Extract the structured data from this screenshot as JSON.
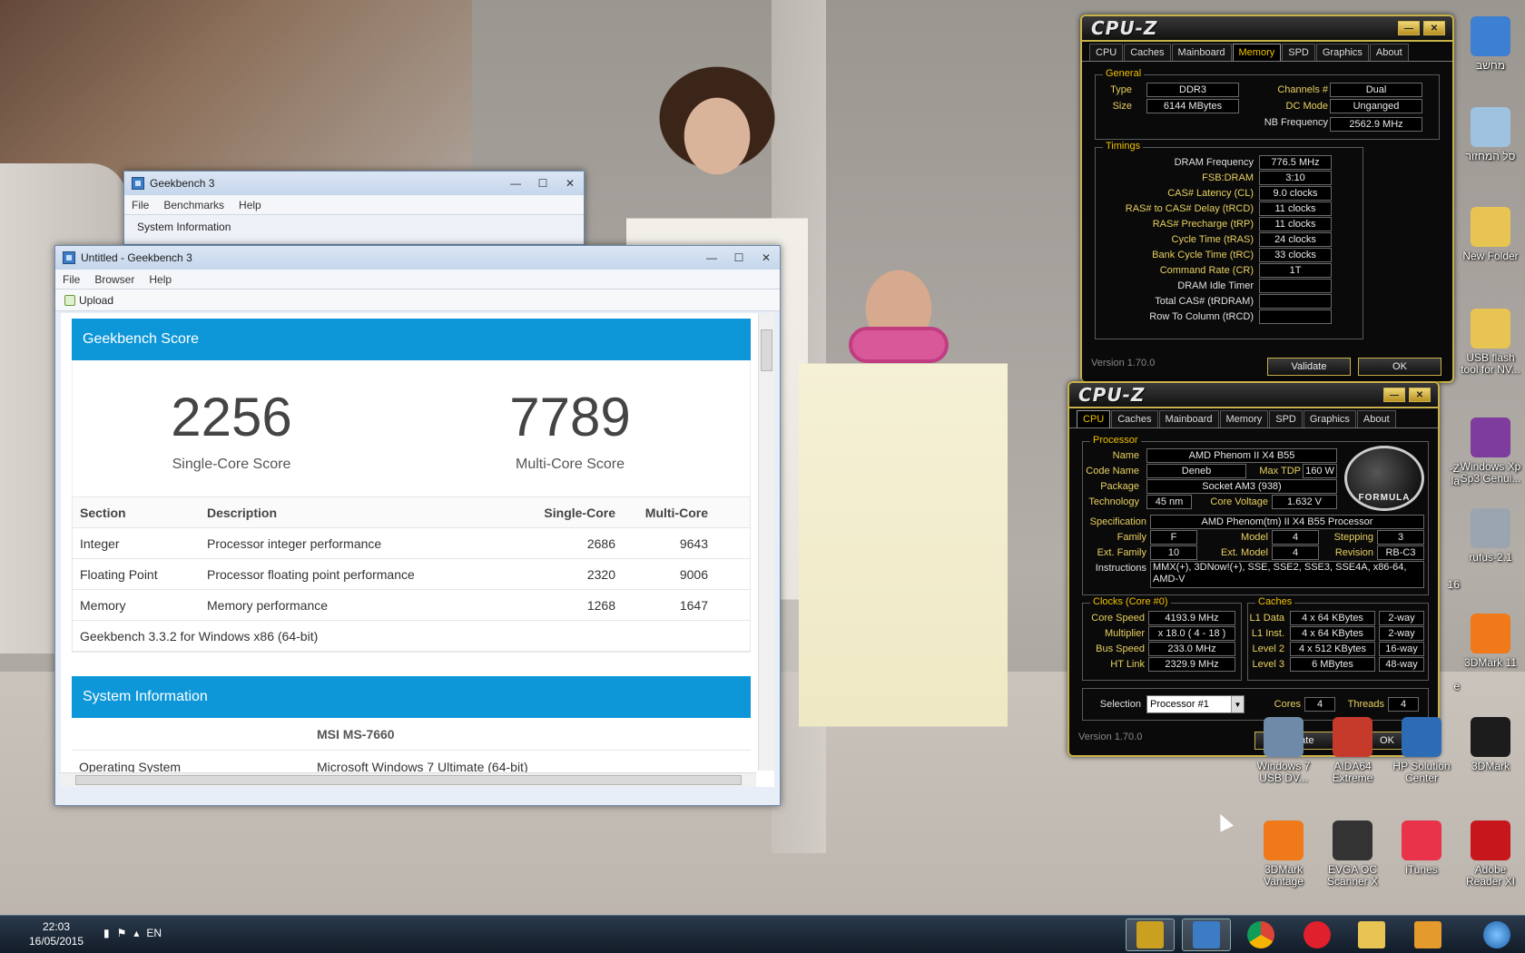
{
  "gb_back": {
    "title": "Geekbench 3",
    "menu": [
      "File",
      "Benchmarks",
      "Help"
    ],
    "section_label": "System Information",
    "btn_min": "—",
    "btn_max": "☐",
    "btn_close": "✕"
  },
  "gb_main": {
    "title": "Untitled - Geekbench 3",
    "menu": [
      "File",
      "Browser",
      "Help"
    ],
    "upload_label": "Upload",
    "score_header": "Geekbench Score",
    "single_score": "2256",
    "single_label": "Single-Core Score",
    "multi_score": "7789",
    "multi_label": "Multi-Core Score",
    "table_headers": [
      "Section",
      "Description",
      "Single-Core",
      "Multi-Core"
    ],
    "rows": [
      {
        "section": "Integer",
        "description": "Processor integer performance",
        "single": "2686",
        "multi": "9643"
      },
      {
        "section": "Floating Point",
        "description": "Processor floating point performance",
        "single": "2320",
        "multi": "9006"
      },
      {
        "section": "Memory",
        "description": "Memory performance",
        "single": "1268",
        "multi": "1647"
      }
    ],
    "version_note": "Geekbench 3.3.2 for Windows x86 (64-bit)",
    "sys_header": "System Information",
    "sys_model": "MSI MS-7660",
    "os_label": "Operating System",
    "os_value": "Microsoft Windows 7 Ultimate (64-bit)"
  },
  "cpuz_mem": {
    "logo": "CPU-Z",
    "tabs": [
      "CPU",
      "Caches",
      "Mainboard",
      "Memory",
      "SPD",
      "Graphics",
      "About"
    ],
    "general_label": "General",
    "type_label": "Type",
    "type": "DDR3",
    "size_label": "Size",
    "size": "6144 MBytes",
    "channels_label": "Channels #",
    "channels": "Dual",
    "dcmode_label": "DC Mode",
    "dcmode": "Unganged",
    "nbfreq_label": "NB Frequency",
    "nbfreq": "2562.9 MHz",
    "timings_label": "Timings",
    "timings": [
      {
        "label": "DRAM Frequency",
        "value": "776.5 MHz"
      },
      {
        "label": "FSB:DRAM",
        "value": "3:10"
      },
      {
        "label": "CAS# Latency (CL)",
        "value": "9.0 clocks"
      },
      {
        "label": "RAS# to CAS# Delay (tRCD)",
        "value": "11 clocks"
      },
      {
        "label": "RAS# Precharge (tRP)",
        "value": "11 clocks"
      },
      {
        "label": "Cycle Time (tRAS)",
        "value": "24 clocks"
      },
      {
        "label": "Bank Cycle Time (tRC)",
        "value": "33 clocks"
      },
      {
        "label": "Command Rate (CR)",
        "value": "1T"
      },
      {
        "label": "DRAM Idle Timer",
        "value": ""
      },
      {
        "label": "Total CAS# (tRDRAM)",
        "value": ""
      },
      {
        "label": "Row To Column (tRCD)",
        "value": ""
      }
    ],
    "version": "Version 1.70.0",
    "validate": "Validate",
    "ok": "OK"
  },
  "cpuz_cpu": {
    "logo": "CPU-Z",
    "tabs": [
      "CPU",
      "Caches",
      "Mainboard",
      "Memory",
      "SPD",
      "Graphics",
      "About"
    ],
    "processor_label": "Processor",
    "name_label": "Name",
    "name": "AMD Phenom II X4 B55",
    "codename_label": "Code Name",
    "codename": "Deneb",
    "maxtdp_label": "Max TDP",
    "maxtdp": "160 W",
    "package_label": "Package",
    "package": "Socket AM3 (938)",
    "tech_label": "Technology",
    "tech": "45 nm",
    "corevolt_label": "Core Voltage",
    "corevolt": "1.632 V",
    "spec_label": "Specification",
    "spec": "AMD Phenom(tm) II X4 B55 Processor",
    "family_label": "Family",
    "family": "F",
    "model_label": "Model",
    "model": "4",
    "stepping_label": "Stepping",
    "stepping": "3",
    "extfamily_label": "Ext. Family",
    "extfamily": "10",
    "extmodel_label": "Ext. Model",
    "extmodel": "4",
    "revision_label": "Revision",
    "revision": "RB-C3",
    "instr_label": "Instructions",
    "instr": "MMX(+), 3DNow!(+), SSE, SSE2, SSE3, SSE4A, x86-64, AMD-V",
    "clocks_label": "Clocks (Core #0)",
    "corespeed_label": "Core Speed",
    "corespeed": "4193.9 MHz",
    "mult_label": "Multiplier",
    "mult": "x 18.0 ( 4 - 18 )",
    "bus_label": "Bus Speed",
    "bus": "233.0 MHz",
    "ht_label": "HT Link",
    "ht": "2329.9 MHz",
    "caches_label": "Caches",
    "l1d_label": "L1 Data",
    "l1d": "4 x 64 KBytes",
    "l1d_way": "2-way",
    "l1i_label": "L1 Inst.",
    "l1i": "4 x 64 KBytes",
    "l1i_way": "2-way",
    "l2_label": "Level 2",
    "l2": "4 x 512 KBytes",
    "l2_way": "16-way",
    "l3_label": "Level 3",
    "l3": "6 MBytes",
    "l3_way": "48-way",
    "selection_label": "Selection",
    "selection": "Processor #1",
    "cores_label": "Cores",
    "cores": "4",
    "threads_label": "Threads",
    "threads": "4",
    "brand": "FORMULA",
    "version": "Version 1.70.0",
    "validate": "Validate",
    "ok": "OK"
  },
  "desktop_icons": [
    {
      "label": "מחשב",
      "icon": "computer-icon",
      "color": "#3d7fd1"
    },
    {
      "label": "סל המחזור",
      "icon": "recycle-bin-icon",
      "color": "#9fc2e0"
    },
    {
      "label": "New Folder",
      "icon": "folder-icon",
      "color": "#e8c552"
    },
    {
      "label": "USB flash tool for NV...",
      "icon": "folder-icon",
      "color": "#e8c552"
    },
    {
      "label": "Windows Xp Sp3 Genui...",
      "icon": "winrar-icon",
      "color": "#7d3c9e"
    },
    {
      "label": "rufus-2.1",
      "icon": "usb-drive-icon",
      "color": "#9aa5b0"
    },
    {
      "label": "3DMark 11",
      "icon": "3dmark-icon",
      "color": "#f07a1a"
    },
    {
      "label": "3DMark",
      "icon": "3dmark-icon",
      "color": "#1c1c1c"
    },
    {
      "label": "Windows 7 USB DV...",
      "icon": "usb-tool-icon",
      "color": "#6e8aa8"
    },
    {
      "label": "AIDA64 Extreme",
      "icon": "aida-icon",
      "color": "#c53a2b"
    },
    {
      "label": "HP Solution Center",
      "icon": "hp-icon",
      "color": "#2d6cb4"
    },
    {
      "label": "3DMark Vantage",
      "icon": "3dmark-icon",
      "color": "#f07a1a"
    },
    {
      "label": "EVGA OC Scanner X",
      "icon": "evga-icon",
      "color": "#333333"
    },
    {
      "label": "iTunes",
      "icon": "itunes-icon",
      "color": "#e8334a"
    },
    {
      "label": "Adobe Reader XI",
      "icon": "adobe-icon",
      "color": "#c8161d"
    }
  ],
  "side_fragments": [
    "-Z",
    "la",
    "16",
    "e"
  ],
  "taskbar": {
    "time": "22:03",
    "date": "16/05/2015",
    "lang": "EN"
  }
}
